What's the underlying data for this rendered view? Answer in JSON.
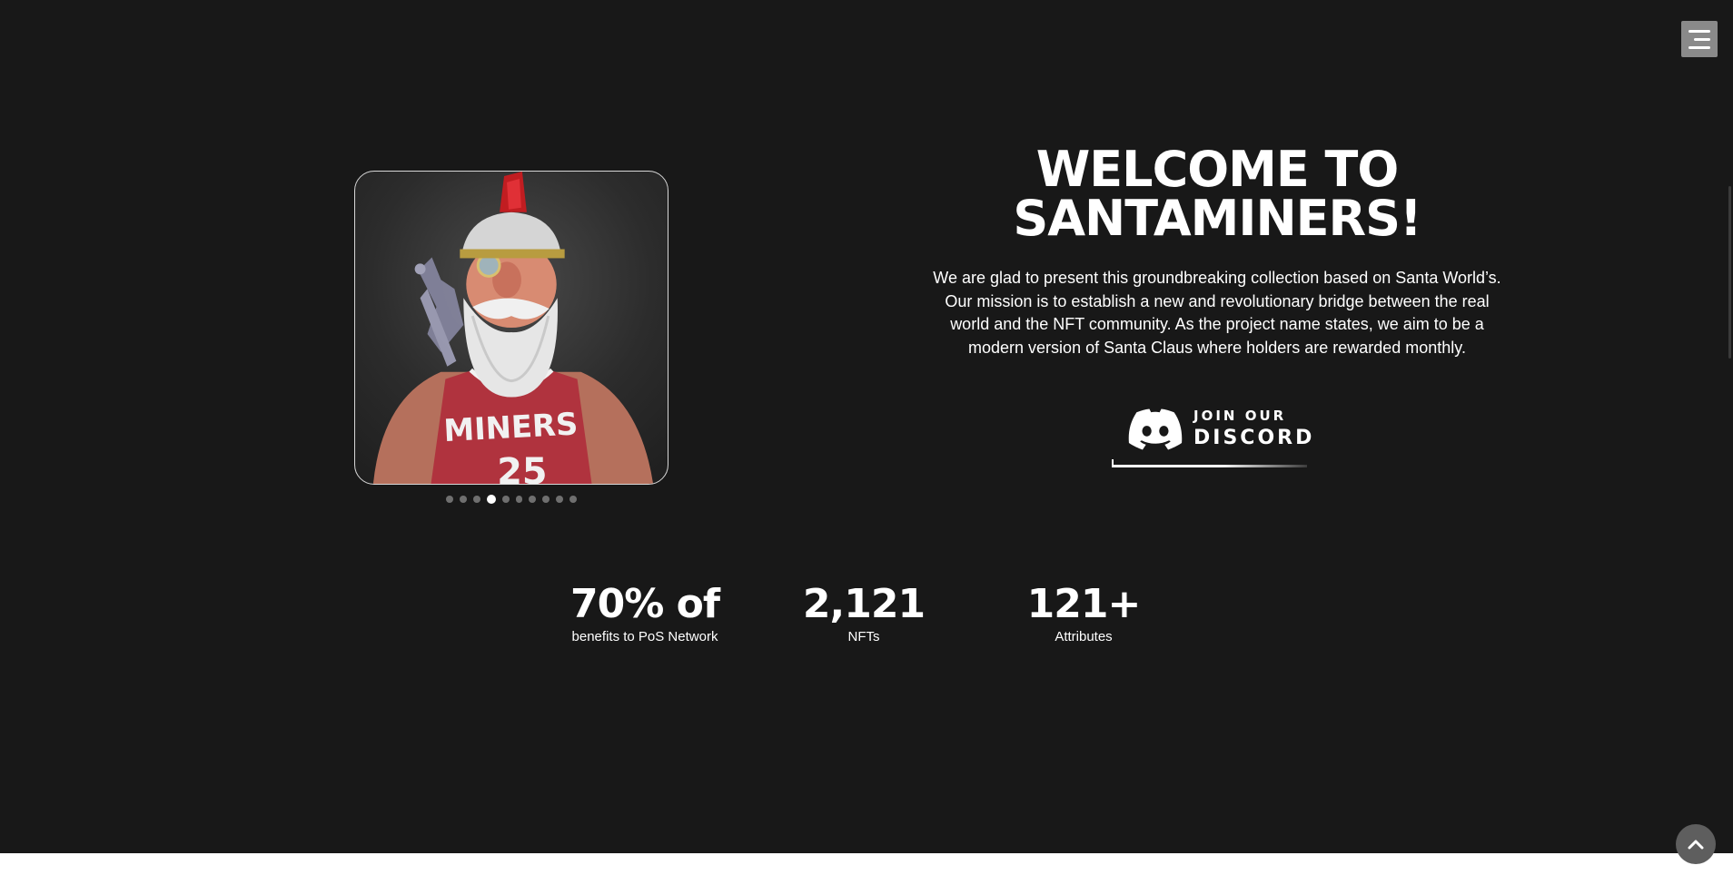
{
  "header": {
    "menu_button": {
      "icon": "hamburger-menu-icon"
    }
  },
  "hero": {
    "carousel": {
      "slide_count": 10,
      "active_index": 3,
      "image": "santa-miner-character-portrait"
    },
    "title_line1": "WELCOME TO",
    "title_line2": "SANTAMINERS!",
    "description": "We are glad to present this groundbreaking collection based on Santa World’s. Our mission is to establish a new and revolutionary bridge between the real world and the NFT community. As the project name states, we aim to be a modern version of Santa Claus where holders are rewarded monthly.",
    "discord_button": {
      "icon": "discord-icon",
      "small_label": "JOIN OUR",
      "big_label": "DISCORD"
    }
  },
  "stats": [
    {
      "value": "70% of",
      "label": "benefits to PoS Network"
    },
    {
      "value": "2,121",
      "label": "NFTs"
    },
    {
      "value": "121+",
      "label": "Attributes"
    }
  ],
  "scroll_top_button": {
    "icon": "chevron-up-icon"
  },
  "colors": {
    "background": "#181818",
    "text": "#ffffff",
    "menu_button": "#8a8a8a",
    "dot_inactive": "#6f6f6f",
    "dot_active": "#ffffff",
    "scroll_top": "#5e5e5e"
  }
}
